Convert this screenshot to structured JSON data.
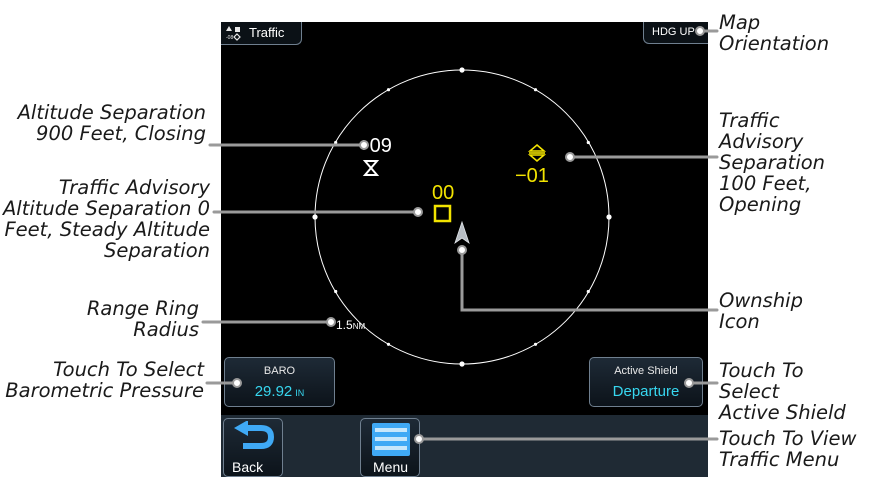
{
  "screen": {
    "title": "Traffic",
    "orientation_badge": "HDG UP",
    "range_value": "1.5",
    "range_unit": "NM",
    "targets": {
      "white_target_altitude": "+09",
      "yellow_target_1_altitude": "00",
      "yellow_target_2_altitude": "−01"
    },
    "baro": {
      "title": "BARO",
      "value": "29.92",
      "unit": "IN"
    },
    "active_shield": {
      "title": "Active Shield",
      "value": "Departure"
    },
    "back_label": "Back",
    "menu_label": "Menu"
  },
  "callouts": {
    "map_orientation": "Map\nOrientation",
    "altitude_separation_900": "Altitude Separation\n900 Feet, Closing",
    "ta_altitude_separation_0": "Traffic Advisory\nAltitude Separation 0\nFeet, Steady Altitude\nSeparation",
    "range_ring_radius": "Range Ring\nRadius",
    "touch_baro": "Touch To Select\nBarometric Pressure",
    "ta_separation_100": "Traffic\nAdvisory\nSeparation\n100 Feet,\nOpening",
    "ownship_icon": "Ownship\nIcon",
    "touch_active_shield": "Touch To Select\nActive Shield",
    "touch_menu": "Touch To View\nTraffic Menu"
  },
  "colors": {
    "screen_bg": "#000000",
    "traffic_advisory": "#f2e300",
    "value_cyan": "#37d7f0",
    "button_bar": "#1f2a34"
  },
  "icons": [
    "traffic-icon",
    "ownship-icon",
    "back-arrow-icon",
    "menu-icon",
    "climb-descend-icon",
    "descending-arrow-icon"
  ]
}
